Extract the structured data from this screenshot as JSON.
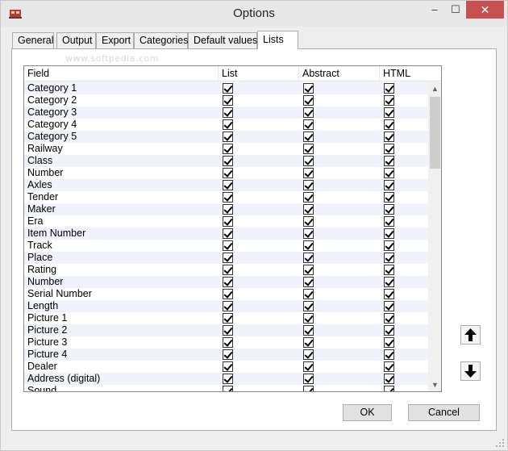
{
  "window": {
    "title": "Options"
  },
  "controls": {
    "minimize": "–",
    "maximize": "☐",
    "close": "✕"
  },
  "tabs": [
    {
      "label": "General"
    },
    {
      "label": "Output"
    },
    {
      "label": "Export"
    },
    {
      "label": "Categories"
    },
    {
      "label": "Default values"
    },
    {
      "label": "Lists"
    }
  ],
  "active_tab": "Lists",
  "watermark": "www.softpedia.com",
  "list": {
    "columns": [
      "Field",
      "List",
      "Abstract",
      "HTML"
    ],
    "rows": [
      {
        "field": "Category 1",
        "list": true,
        "abstract": true,
        "html": true
      },
      {
        "field": "Category 2",
        "list": true,
        "abstract": true,
        "html": true
      },
      {
        "field": "Category 3",
        "list": true,
        "abstract": true,
        "html": true
      },
      {
        "field": "Category 4",
        "list": true,
        "abstract": true,
        "html": true
      },
      {
        "field": "Category 5",
        "list": true,
        "abstract": true,
        "html": true
      },
      {
        "field": "Railway",
        "list": true,
        "abstract": true,
        "html": true
      },
      {
        "field": "Class",
        "list": true,
        "abstract": true,
        "html": true
      },
      {
        "field": "Number",
        "list": true,
        "abstract": true,
        "html": true
      },
      {
        "field": "Axles",
        "list": true,
        "abstract": true,
        "html": true
      },
      {
        "field": "Tender",
        "list": true,
        "abstract": true,
        "html": true
      },
      {
        "field": "Maker",
        "list": true,
        "abstract": true,
        "html": true
      },
      {
        "field": "Era",
        "list": true,
        "abstract": true,
        "html": true
      },
      {
        "field": "Item Number",
        "list": true,
        "abstract": true,
        "html": true
      },
      {
        "field": "Track",
        "list": true,
        "abstract": true,
        "html": true
      },
      {
        "field": "Place",
        "list": true,
        "abstract": true,
        "html": true
      },
      {
        "field": "Rating",
        "list": true,
        "abstract": true,
        "html": true
      },
      {
        "field": "Number",
        "list": true,
        "abstract": true,
        "html": true
      },
      {
        "field": "Serial Number",
        "list": true,
        "abstract": true,
        "html": true
      },
      {
        "field": "Length",
        "list": true,
        "abstract": true,
        "html": true
      },
      {
        "field": "Picture 1",
        "list": true,
        "abstract": true,
        "html": true
      },
      {
        "field": "Picture 2",
        "list": true,
        "abstract": true,
        "html": true
      },
      {
        "field": "Picture 3",
        "list": true,
        "abstract": true,
        "html": true
      },
      {
        "field": "Picture 4",
        "list": true,
        "abstract": true,
        "html": true
      },
      {
        "field": "Dealer",
        "list": true,
        "abstract": true,
        "html": true
      },
      {
        "field": "Address (digital)",
        "list": true,
        "abstract": true,
        "html": true
      },
      {
        "field": "Sound",
        "list": true,
        "abstract": true,
        "html": true
      }
    ]
  },
  "buttons": {
    "ok": "OK",
    "cancel": "Cancel"
  },
  "icons": {
    "app": "app-icon",
    "move_up": "arrow-up-icon",
    "move_down": "arrow-down-icon",
    "scroll_up": "▲",
    "scroll_down": "▼"
  }
}
